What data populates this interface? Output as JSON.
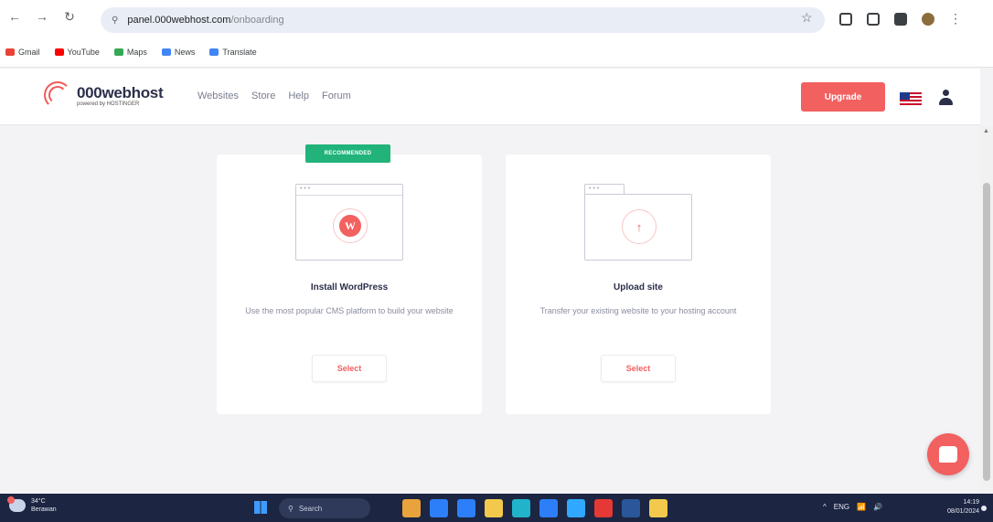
{
  "browser": {
    "nav": {
      "back": "←",
      "forward": "→",
      "reload": "↻"
    },
    "tune_icon": "⚲",
    "url_host": "panel.000webhost.com",
    "url_path": "/onboarding",
    "star_icon": "☆",
    "menu_icon": "⋮",
    "bookmarks": [
      {
        "label": "Gmail",
        "color": "#ea4335"
      },
      {
        "label": "YouTube",
        "color": "#ff0000"
      },
      {
        "label": "Maps",
        "color": "#34a853"
      },
      {
        "label": "News",
        "color": "#4285f4"
      },
      {
        "label": "Translate",
        "color": "#4285f4"
      }
    ]
  },
  "site": {
    "logo_name": "000webhost",
    "logo_sub": "powered by HOSTINGER",
    "nav": [
      "Websites",
      "Store",
      "Help",
      "Forum"
    ],
    "upgrade_label": "Upgrade"
  },
  "cards": {
    "badge": "RECOMMENDED",
    "wordpress": {
      "window_dots": "• • •",
      "icon_glyph": "W",
      "title": "Install WordPress",
      "desc": "Use the most popular CMS platform to build your website",
      "select": "Select"
    },
    "upload": {
      "window_dots": "• • •",
      "icon_glyph": "↑",
      "title": "Upload site",
      "desc": "Transfer your existing website to your hosting account",
      "select": "Select"
    }
  },
  "taskbar": {
    "temp": "34°C",
    "weather": "Berawan",
    "search": "Search",
    "tray": [
      "^",
      "ENG",
      "📶",
      "🔊"
    ],
    "time": "14:19",
    "date": "08/01/2024",
    "apps": [
      "#e8a33d",
      "#2d7ff9",
      "#2d7ff9",
      "#f2c94c",
      "#21b3c9",
      "#2d7ff9",
      "#31a8ff",
      "#e53935",
      "#2b579a",
      "#f2c94c"
    ]
  },
  "colors": {
    "accent": "#f26060",
    "badge": "#21b37a",
    "navy": "#2b2f4a"
  }
}
